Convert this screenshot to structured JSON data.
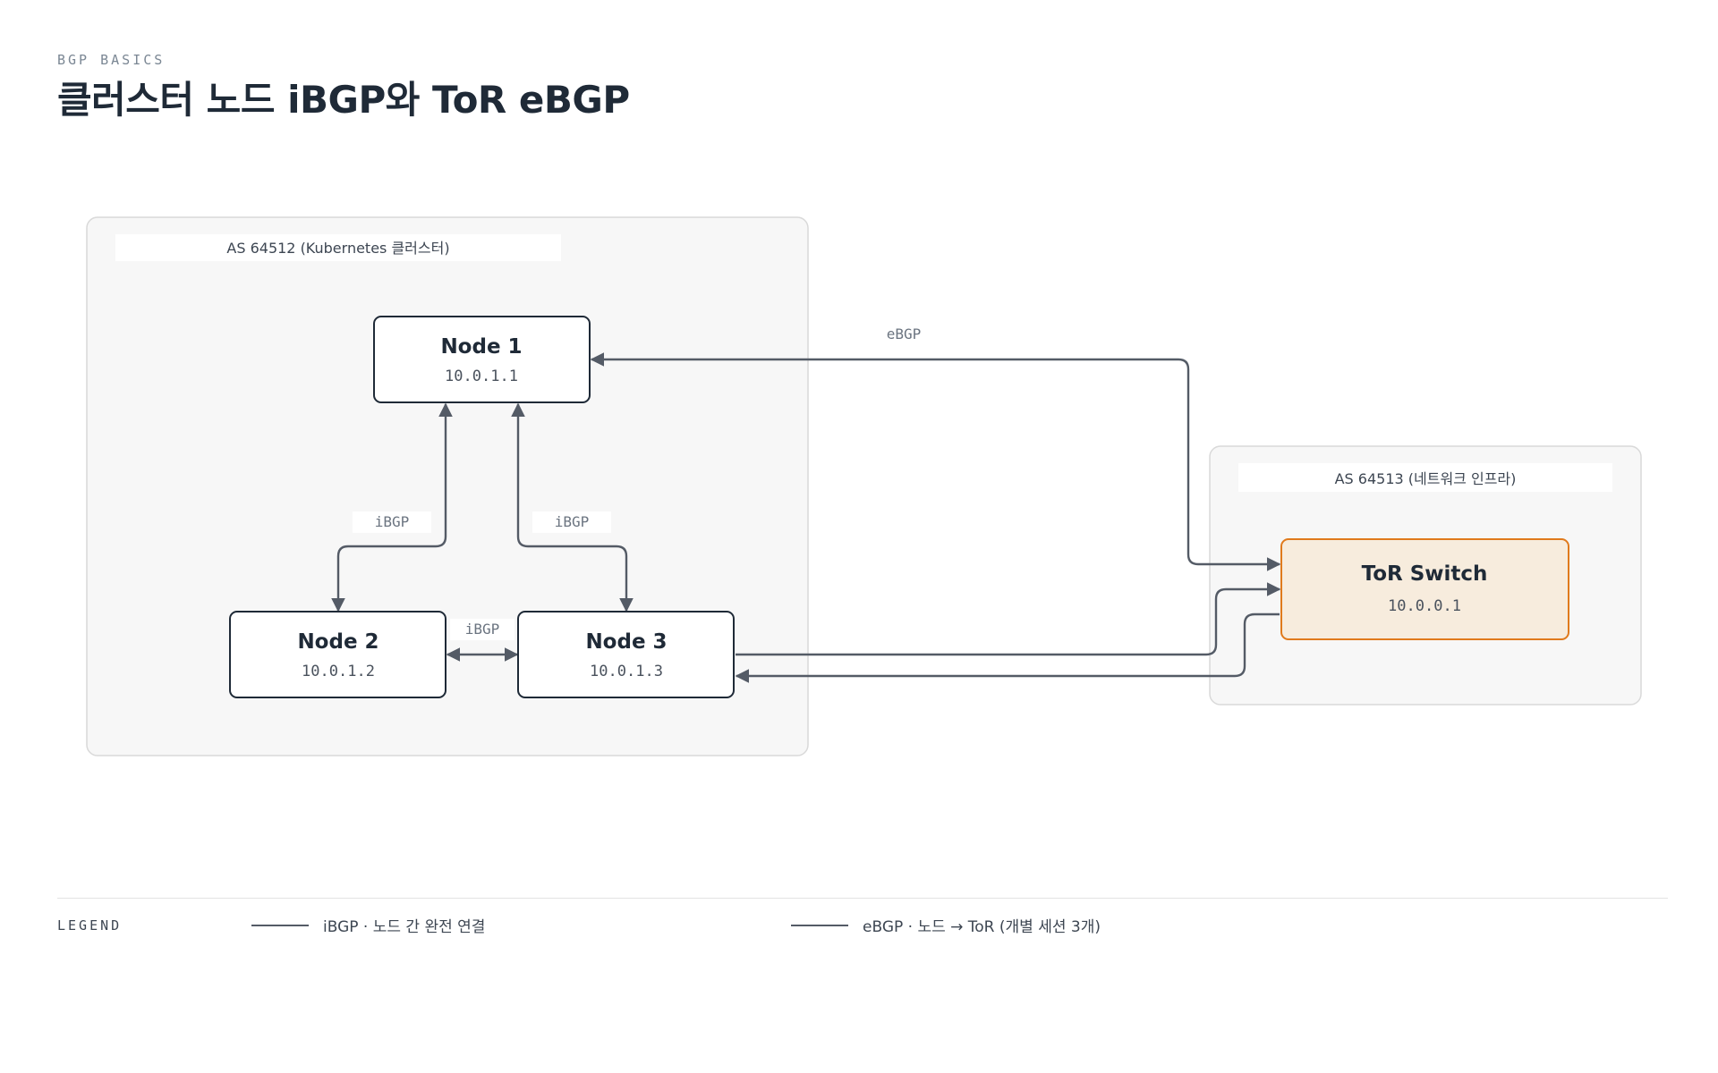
{
  "header": {
    "eyebrow": "BGP BASICS",
    "title": "클러스터 노드 iBGP와 ToR eBGP"
  },
  "groups": {
    "cluster": {
      "label": "AS 64512 (Kubernetes 클러스터)"
    },
    "network": {
      "label": "AS 64513 (네트워크 인프라)"
    }
  },
  "nodes": {
    "node1": {
      "name": "Node 1",
      "ip": "10.0.1.1"
    },
    "node2": {
      "name": "Node 2",
      "ip": "10.0.1.2"
    },
    "node3": {
      "name": "Node 3",
      "ip": "10.0.1.3"
    },
    "tor": {
      "name": "ToR Switch",
      "ip": "10.0.0.1"
    }
  },
  "edges": {
    "ibgp_1_2": "iBGP",
    "ibgp_1_3": "iBGP",
    "ibgp_2_3": "iBGP",
    "ebgp_1_tor": "eBGP"
  },
  "legend": {
    "title": "LEGEND",
    "items": [
      {
        "label": "iBGP · 노드 간 완전 연결"
      },
      {
        "label": "eBGP · 노드 → ToR (개별 세션 3개)"
      }
    ]
  },
  "colors": {
    "edge": "#545b66",
    "node_border": "#1f2a37",
    "tor_fill": "#f7ecdd",
    "tor_border": "#e07a1c",
    "group_fill": "#f7f7f7"
  }
}
